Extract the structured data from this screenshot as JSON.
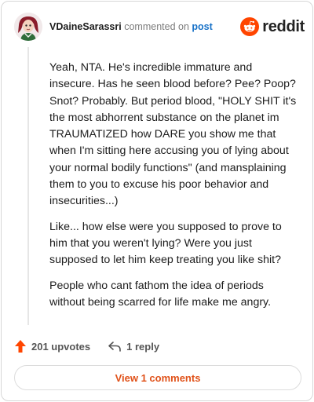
{
  "header": {
    "username": "VDaineSarassri",
    "verb": "commented on",
    "post_link": "post"
  },
  "brand": {
    "wordmark": "reddit",
    "icon": "reddit-alien-icon",
    "color": "#ff4500"
  },
  "comment": {
    "paragraphs": [
      "Yeah, NTA. He's incredible immature and insecure. Has he seen blood before? Pee? Poop? Snot? Probably. But period blood, \"HOLY SHIT it's the most abhorrent substance on the planet im TRAUMATIZED how DARE you show me that when I'm sitting here accusing you of lying about your normal bodily functions\" (and mansplaining them to you to excuse his poor behavior and insecurities...)",
      "Like... how else were you supposed to prove to him that you weren't lying? Were you just supposed to let him keep treating you like shit?",
      "People who cant fathom the idea of periods without being scarred for life make me angry."
    ]
  },
  "actions": {
    "upvotes": "201 upvotes",
    "replies": "1 reply",
    "upvote_icon": "upvote-arrow-icon",
    "reply_icon": "reply-arrow-icon",
    "upvote_color": "#ff4500"
  },
  "footer": {
    "view_comments": "View 1 comments",
    "accent": "#e0521a"
  }
}
